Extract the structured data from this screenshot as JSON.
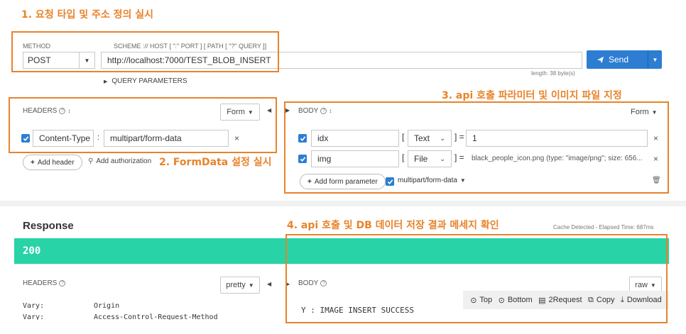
{
  "annotations": {
    "a1": "1. 요청 타입 및 주소 정의 실시",
    "a2": "2. FormData 설정 실시",
    "a3": "3. api 호출 파라미터 및 이미지 파일 지정",
    "a4": "4. api 호출 및 DB 데이터 저장 결과 메세지 확인"
  },
  "request": {
    "method_label": "METHOD",
    "method_value": "POST",
    "scheme_label": "SCHEME :// HOST [ \":\" PORT ] [ PATH [ \"?\" QUERY ]]",
    "url": "http://localhost:7000/TEST_BLOB_INSERT",
    "send_label": "Send",
    "length_text": "length: 38 byte(s)",
    "query_params_label": "QUERY PARAMETERS"
  },
  "headers": {
    "title": "HEADERS",
    "form_label": "Form",
    "rows": [
      {
        "name": "Content-Type",
        "value": "multipart/form-data"
      }
    ],
    "add_header_label": "Add header",
    "add_auth_label": "Add authorization"
  },
  "body": {
    "title": "BODY",
    "form_label": "Form",
    "rows": [
      {
        "name": "idx",
        "type": "Text",
        "value": "1"
      },
      {
        "name": "img",
        "type": "File",
        "value": "black_people_icon.png (type: \"image/png\"; size: 656..."
      }
    ],
    "add_param_label": "Add form parameter",
    "encoding_label": "multipart/form-data"
  },
  "response": {
    "title": "Response",
    "cache_text": "Cache Detected - Elapsed Time: 687ms",
    "status_code": "200",
    "headers_title": "HEADERS",
    "pretty_label": "pretty",
    "header_rows": [
      {
        "name": "Vary:",
        "value": "Origin"
      },
      {
        "name": "Vary:",
        "value": "Access-Control-Request-Method"
      }
    ],
    "body_title": "BODY",
    "raw_label": "raw",
    "body_text": "Y : IMAGE INSERT SUCCESS",
    "toolbar": {
      "top": "Top",
      "bottom": "Bottom",
      "to_request": "2Request",
      "copy": "Copy",
      "download": "Download"
    }
  },
  "colors": {
    "accent": "#e8832a",
    "send_blue": "#2d7dd2",
    "status_green": "#27d3a7"
  }
}
